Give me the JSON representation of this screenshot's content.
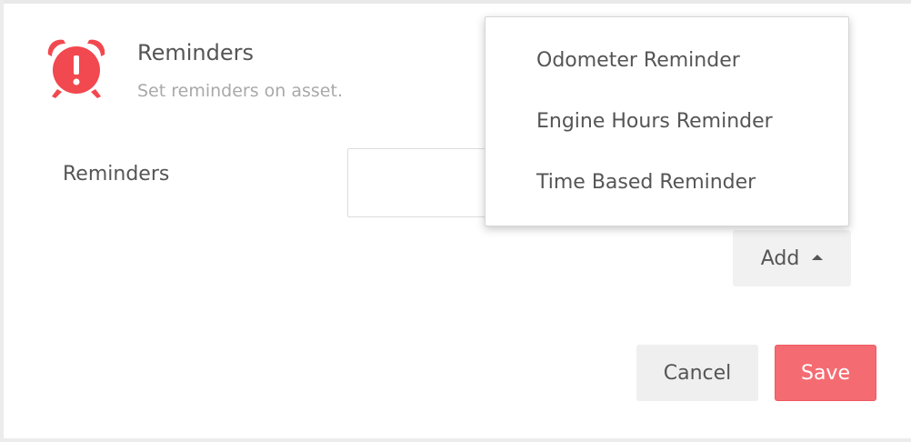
{
  "section": {
    "title": "Reminders",
    "subtitle": "Set reminders on asset.",
    "icon": "alarm-clock-alert-icon",
    "icon_color": "#f2484f"
  },
  "reminders_field": {
    "label": "Reminders",
    "value": ""
  },
  "add_menu": {
    "button_label": "Add",
    "expanded": true,
    "items": [
      {
        "label": "Odometer Reminder"
      },
      {
        "label": "Engine Hours Reminder"
      },
      {
        "label": "Time Based Reminder"
      }
    ]
  },
  "actions": {
    "cancel_label": "Cancel",
    "save_label": "Save",
    "save_color": "#f46c72"
  }
}
